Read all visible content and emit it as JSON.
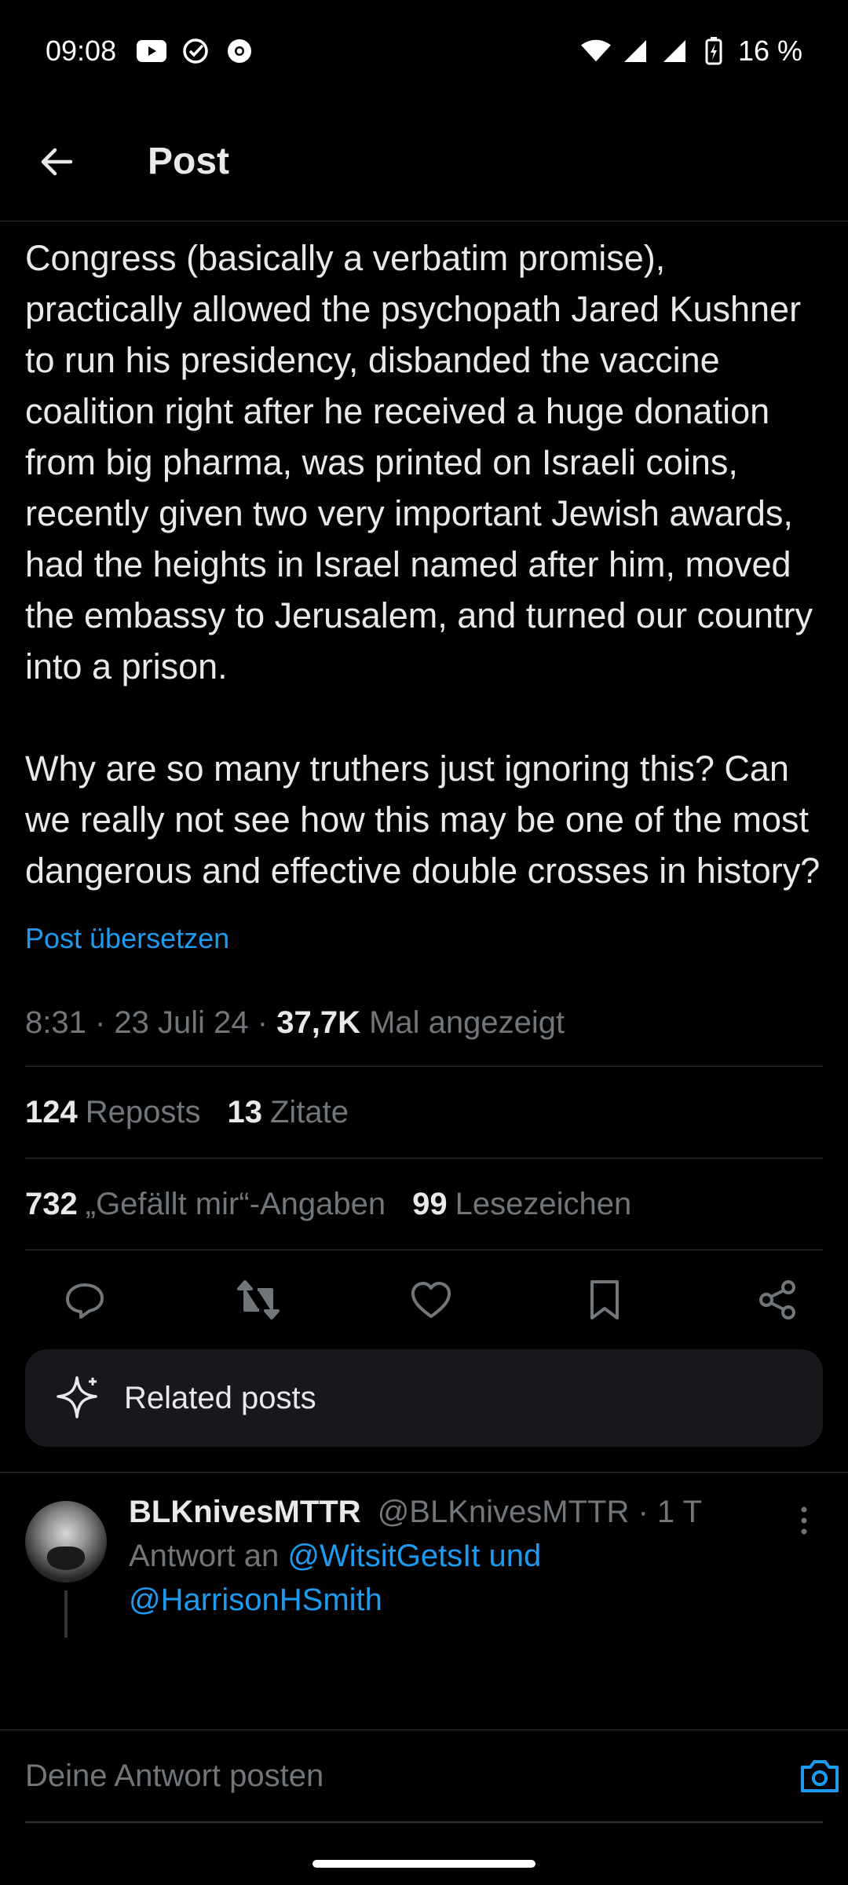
{
  "status_bar": {
    "time": "09:08",
    "battery": "16 %",
    "icons": [
      "youtube-icon",
      "check-circle-icon",
      "chrome-icon",
      "wifi-icon",
      "signal-icon",
      "signal-icon",
      "battery-charging-icon"
    ]
  },
  "header": {
    "title": "Post",
    "back_icon": "arrow-left-icon"
  },
  "post": {
    "paragraph1": "Congress (basically a verbatim promise), practically allowed the psychopath Jared Kushner to run his presidency, disbanded the vaccine coalition right after he received a huge donation from big pharma, was printed on Israeli coins, recently given two very important Jewish awards, had the heights in Israel named after him, moved the embassy to Jerusalem, and turned our country into a prison.",
    "paragraph2": "Why are so many truthers just ignoring this? Can we really not see how this may be one of the most dangerous and effective double crosses in history?",
    "translate_link": "Post übersetzen",
    "time": "8:31",
    "date": "23 Juli 24",
    "views_count": "37,7K",
    "views_label": "Mal angezeigt"
  },
  "stats": {
    "reposts_count": "124",
    "reposts_label": "Reposts",
    "quotes_count": "13",
    "quotes_label": "Zitate",
    "likes_count": "732",
    "likes_label": "„Gefällt mir“-Angaben",
    "bookmarks_count": "99",
    "bookmarks_label": "Lesezeichen"
  },
  "actions": [
    "reply-icon",
    "repost-icon",
    "like-icon",
    "bookmark-icon",
    "share-icon"
  ],
  "related": {
    "label": "Related posts",
    "icon": "sparkle-icon"
  },
  "reply": {
    "name": "BLKnivesMTTR",
    "handle": "@BLKnivesMTTR",
    "age": "· 1 T",
    "reply_to_prefix": "Antwort an",
    "mention1": "@WitsitGetsIt und",
    "mention2": "@HarrisonHSmith"
  },
  "composer": {
    "placeholder": "Deine Antwort posten",
    "camera_icon": "camera-icon"
  },
  "colors": {
    "background": "#000000",
    "text": "#e7e9ea",
    "muted": "#71767b",
    "accent": "#1d9bf0",
    "divider": "#2f3336",
    "card": "#16181c"
  }
}
